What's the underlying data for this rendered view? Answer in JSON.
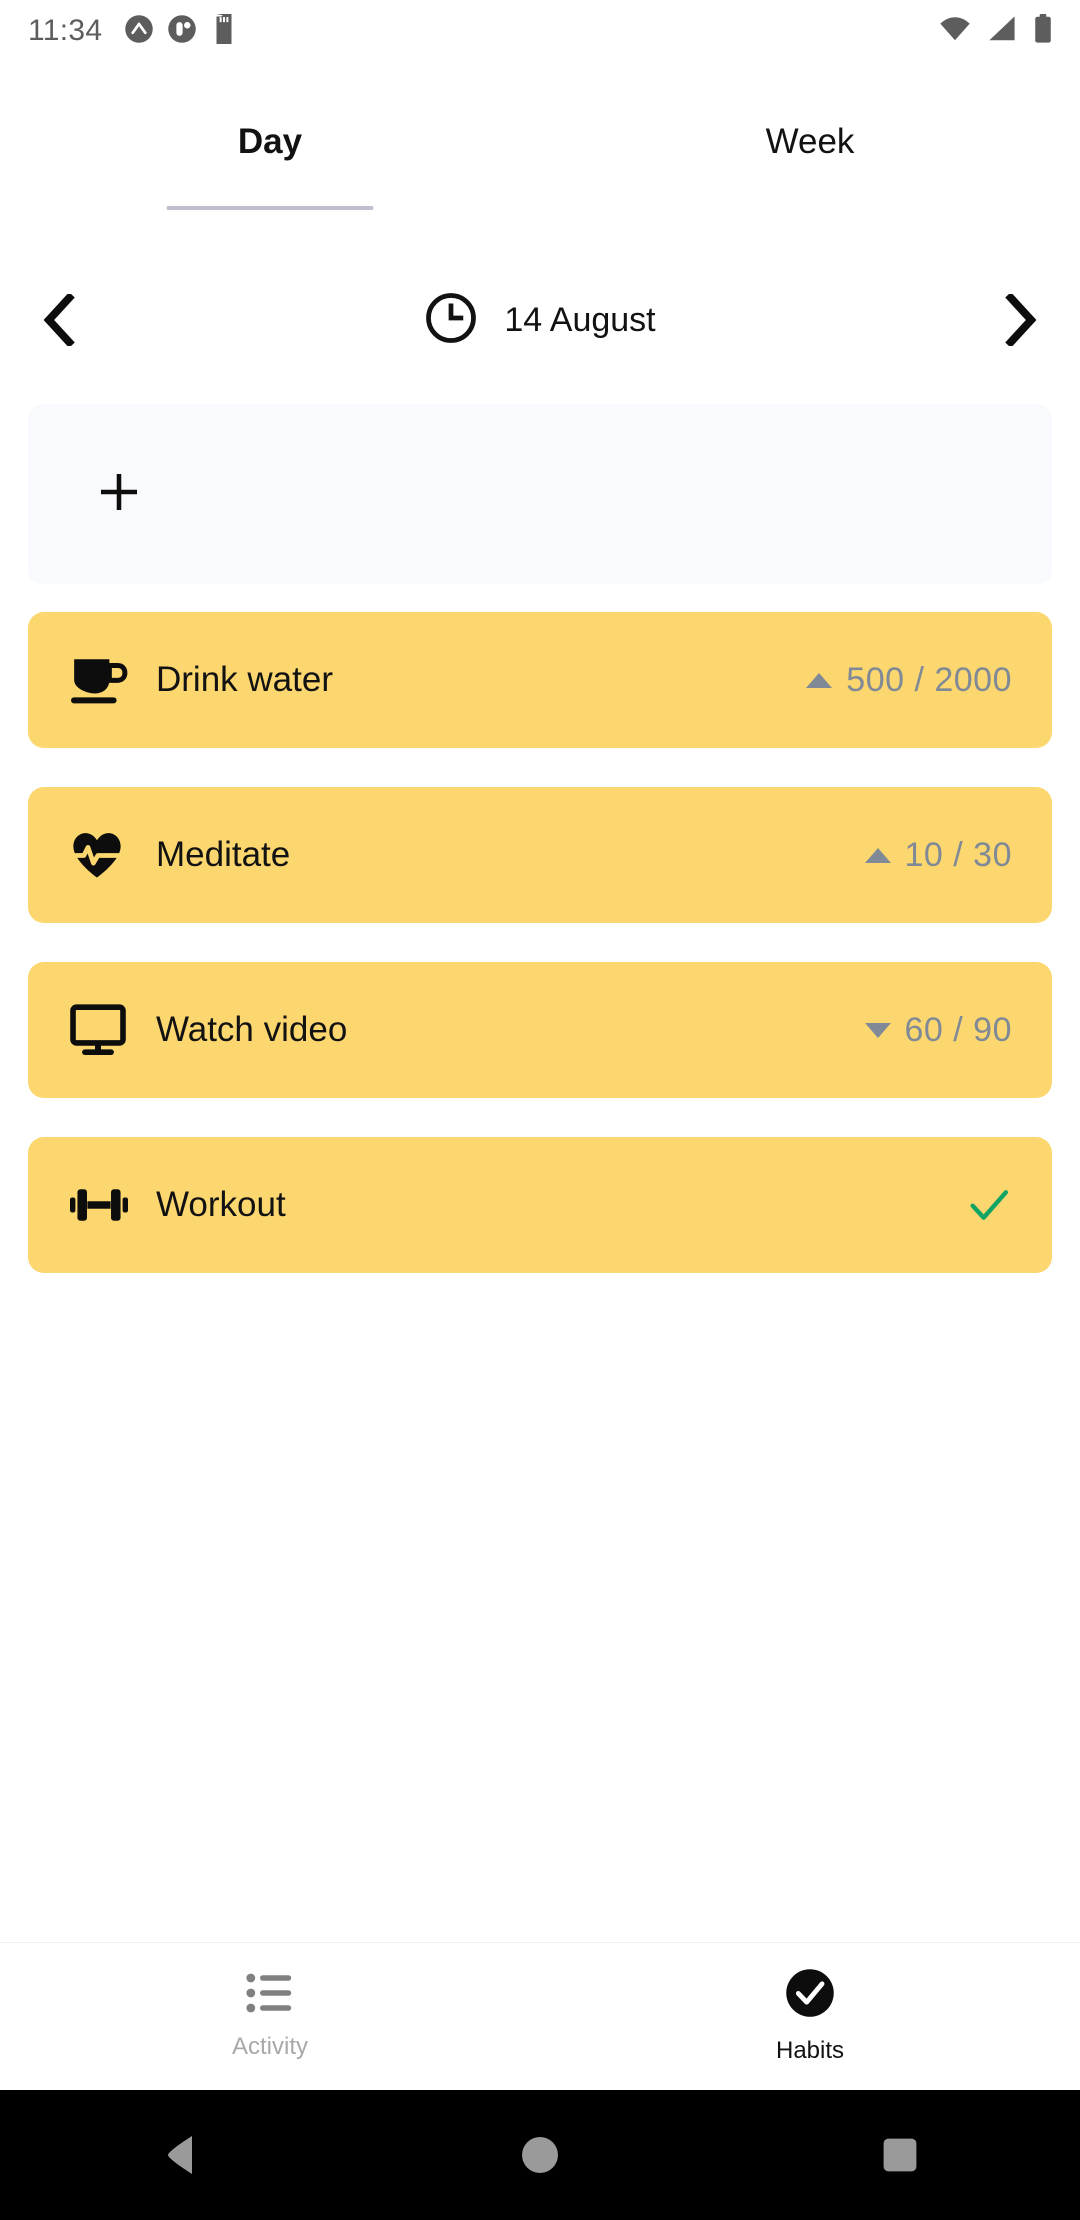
{
  "status_bar": {
    "time": "11:34",
    "left_icons": [
      "chevron-up-circle-icon",
      "app-badge-circle-icon",
      "sd-card-icon"
    ],
    "right_icons": [
      "wifi-icon",
      "cellular-signal-icon",
      "battery-icon"
    ],
    "icon_color": "#5d5d5d"
  },
  "tabs": {
    "items": [
      {
        "label": "Day",
        "active": true
      },
      {
        "label": "Week",
        "active": false
      }
    ],
    "indicator_color": "#bfc0ce"
  },
  "date_nav": {
    "prev_label": "‹",
    "next_label": "›",
    "clock_icon": "clock-icon",
    "date": "14 August"
  },
  "add_card": {
    "icon": "plus-icon",
    "background": "#f8fafd"
  },
  "habits": {
    "card_color": "#fcd66e",
    "progress_color": "#808a96",
    "check_color": "#0fa463",
    "items": [
      {
        "name": "Drink water",
        "icon": "coffee-cup-icon",
        "trend": "up",
        "progress": "500 / 2000",
        "done": false
      },
      {
        "name": "Meditate",
        "icon": "heart-pulse-icon",
        "trend": "up",
        "progress": "10 / 30",
        "done": false
      },
      {
        "name": "Watch video",
        "icon": "monitor-icon",
        "trend": "down",
        "progress": "60 / 90",
        "done": false
      },
      {
        "name": "Workout",
        "icon": "dumbbell-icon",
        "trend": null,
        "progress": null,
        "done": true
      }
    ]
  },
  "bottom_nav": {
    "items": [
      {
        "label": "Activity",
        "icon": "bullet-list-icon",
        "active": false
      },
      {
        "label": "Habits",
        "icon": "check-circle-icon",
        "active": true
      }
    ],
    "inactive_color": "#a8a8a8",
    "active_color": "#121212"
  },
  "android_nav": {
    "buttons": [
      "back-button",
      "home-button",
      "recents-button"
    ],
    "background": "#000000",
    "icon_color": "#9a9a9a"
  }
}
